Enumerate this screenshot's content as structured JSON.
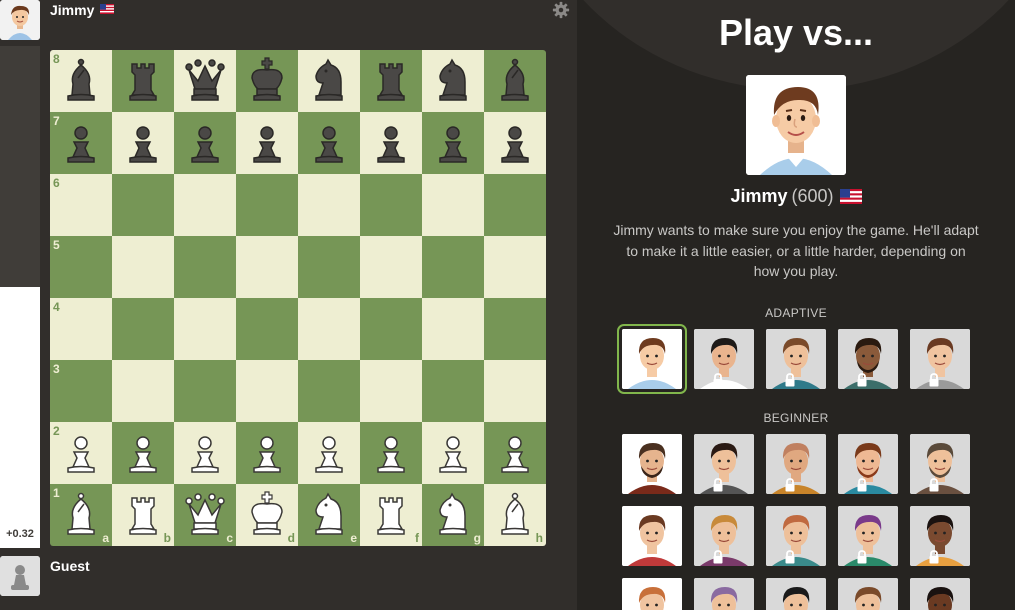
{
  "top_player": {
    "name": "Jimmy",
    "flag": "us-flag-icon"
  },
  "bottom_player": {
    "name": "Guest"
  },
  "eval": {
    "score": "+0.32",
    "white_fraction": 0.52
  },
  "board": {
    "ranks": [
      "8",
      "7",
      "6",
      "5",
      "4",
      "3",
      "2",
      "1"
    ],
    "files": [
      "a",
      "b",
      "c",
      "d",
      "e",
      "f",
      "g",
      "h"
    ],
    "colors": {
      "light": "#eeeed2",
      "dark": "#769656"
    },
    "position": [
      [
        "bB",
        "bR",
        "bQ",
        "bK",
        "bN",
        "bR",
        "bN",
        "bB"
      ],
      [
        "bP",
        "bP",
        "bP",
        "bP",
        "bP",
        "bP",
        "bP",
        "bP"
      ],
      [
        "",
        "",
        "",
        "",
        "",
        "",
        "",
        ""
      ],
      [
        "",
        "",
        "",
        "",
        "",
        "",
        "",
        ""
      ],
      [
        "",
        "",
        "",
        "",
        "",
        "",
        "",
        ""
      ],
      [
        "",
        "",
        "",
        "",
        "",
        "",
        "",
        ""
      ],
      [
        "wP",
        "wP",
        "wP",
        "wP",
        "wP",
        "wP",
        "wP",
        "wP"
      ],
      [
        "wB",
        "wR",
        "wQ",
        "wK",
        "wN",
        "wR",
        "wN",
        "wB"
      ]
    ]
  },
  "panel": {
    "title": "Play vs...",
    "bot": {
      "name": "Jimmy",
      "rating": "(600)",
      "description": "Jimmy wants to make sure you enjoy the game. He'll adapt to make it a little easier, or a little harder, depending on how you play."
    },
    "sections": [
      {
        "label": "ADAPTIVE",
        "rows": [
          [
            {
              "avatar": "jimmy-avatar",
              "selected": true,
              "locked": false
            },
            {
              "avatar": "woman-dark-hair-avatar",
              "selected": false,
              "locked": true
            },
            {
              "avatar": "man-short-hair-avatar",
              "selected": false,
              "locked": true
            },
            {
              "avatar": "bearded-man-avatar",
              "selected": false,
              "locked": true
            },
            {
              "avatar": "woman-bob-avatar",
              "selected": false,
              "locked": true
            }
          ]
        ]
      },
      {
        "label": "BEGINNER",
        "rows": [
          [
            {
              "avatar": "bearded-hat-man-avatar",
              "selected": false,
              "locked": false
            },
            {
              "avatar": "bun-hair-man-avatar",
              "selected": false,
              "locked": true
            },
            {
              "avatar": "bald-man-avatar",
              "selected": false,
              "locked": true
            },
            {
              "avatar": "red-beard-man-avatar",
              "selected": false,
              "locked": true
            },
            {
              "avatar": "gray-beard-man-avatar",
              "selected": false,
              "locked": true
            }
          ],
          [
            {
              "avatar": "woman-bun-avatar",
              "selected": false,
              "locked": false
            },
            {
              "avatar": "blond-man-avatar",
              "selected": false,
              "locked": true
            },
            {
              "avatar": "cap-man-avatar",
              "selected": false,
              "locked": true
            },
            {
              "avatar": "purple-hair-woman-avatar",
              "selected": false,
              "locked": true
            },
            {
              "avatar": "curly-hair-woman-avatar",
              "selected": false,
              "locked": true
            }
          ],
          [
            {
              "avatar": "ginger-man-avatar",
              "selected": false,
              "locked": false
            },
            {
              "avatar": "purple-hood-avatar",
              "selected": false,
              "locked": true
            },
            {
              "avatar": "dark-hair-woman-avatar",
              "selected": false,
              "locked": true
            },
            {
              "avatar": "brown-hair-man-avatar",
              "selected": false,
              "locked": true
            },
            {
              "avatar": "dark-man-avatar",
              "selected": false,
              "locked": true
            }
          ]
        ]
      }
    ]
  }
}
